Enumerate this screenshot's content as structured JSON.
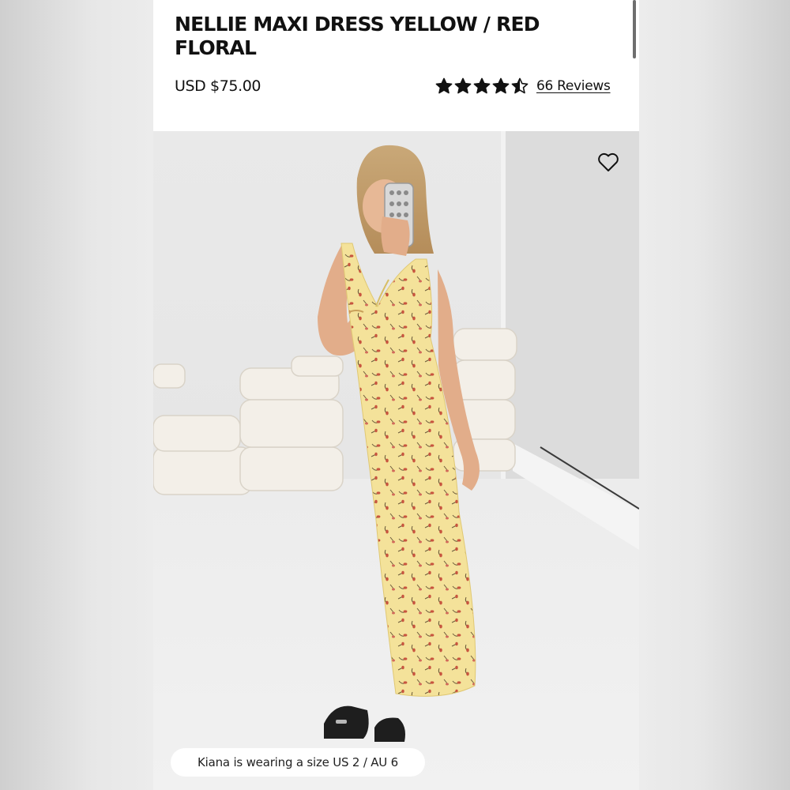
{
  "product": {
    "title": "NELLIE MAXI DRESS YELLOW / RED FLORAL",
    "price": "USD $75.00",
    "rating": 4.5,
    "rating_max": 5,
    "reviews_label": "66 Reviews"
  },
  "gallery": {
    "model_note": "Kiana is wearing a size US 2 / AU 6",
    "wishlist_icon": "heart-outline-icon"
  },
  "colors": {
    "dress": "#f4e29a",
    "print": "#c8553f",
    "text": "#111111"
  }
}
